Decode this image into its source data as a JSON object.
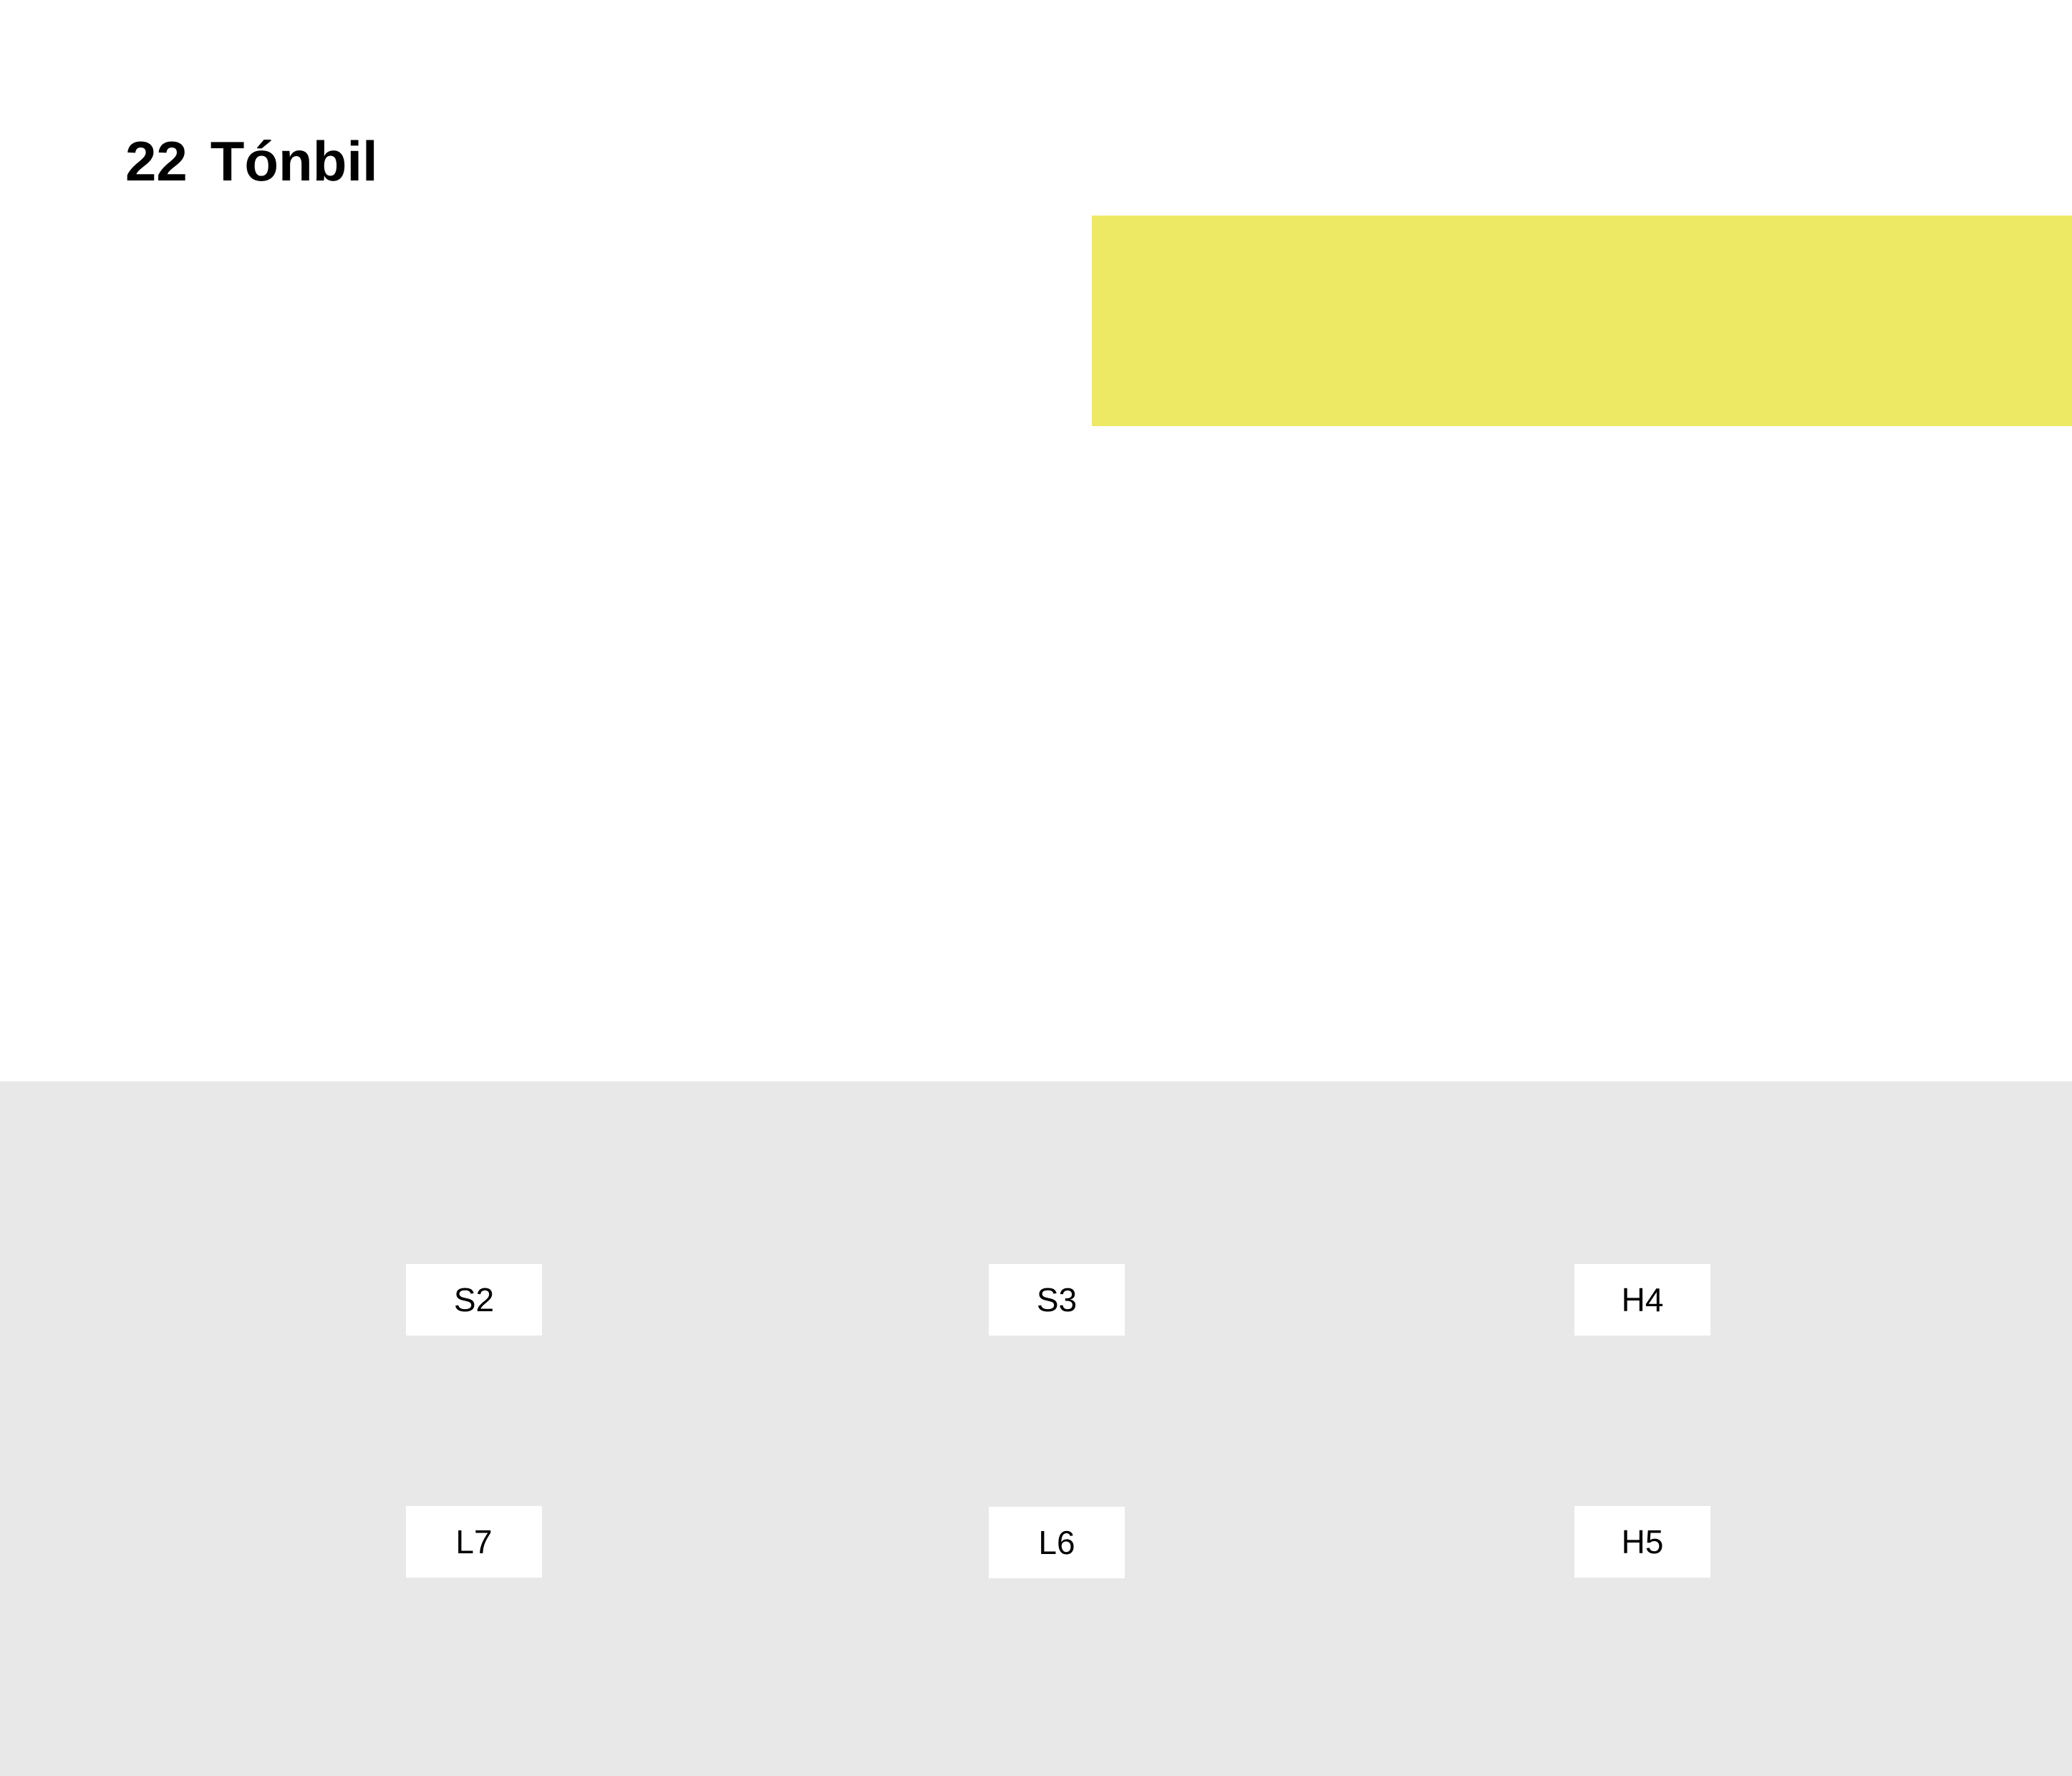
{
  "header": {
    "number": "22",
    "title": "Tónbil"
  },
  "colors": {
    "banner": "#EEE964",
    "answer_area_background": "#E8E8E8",
    "choice_background": "#FFFFFF",
    "text": "#000000"
  },
  "choices": [
    {
      "label": "S2"
    },
    {
      "label": "S3"
    },
    {
      "label": "H4"
    },
    {
      "label": "L7"
    },
    {
      "label": "L6"
    },
    {
      "label": "H5"
    }
  ]
}
